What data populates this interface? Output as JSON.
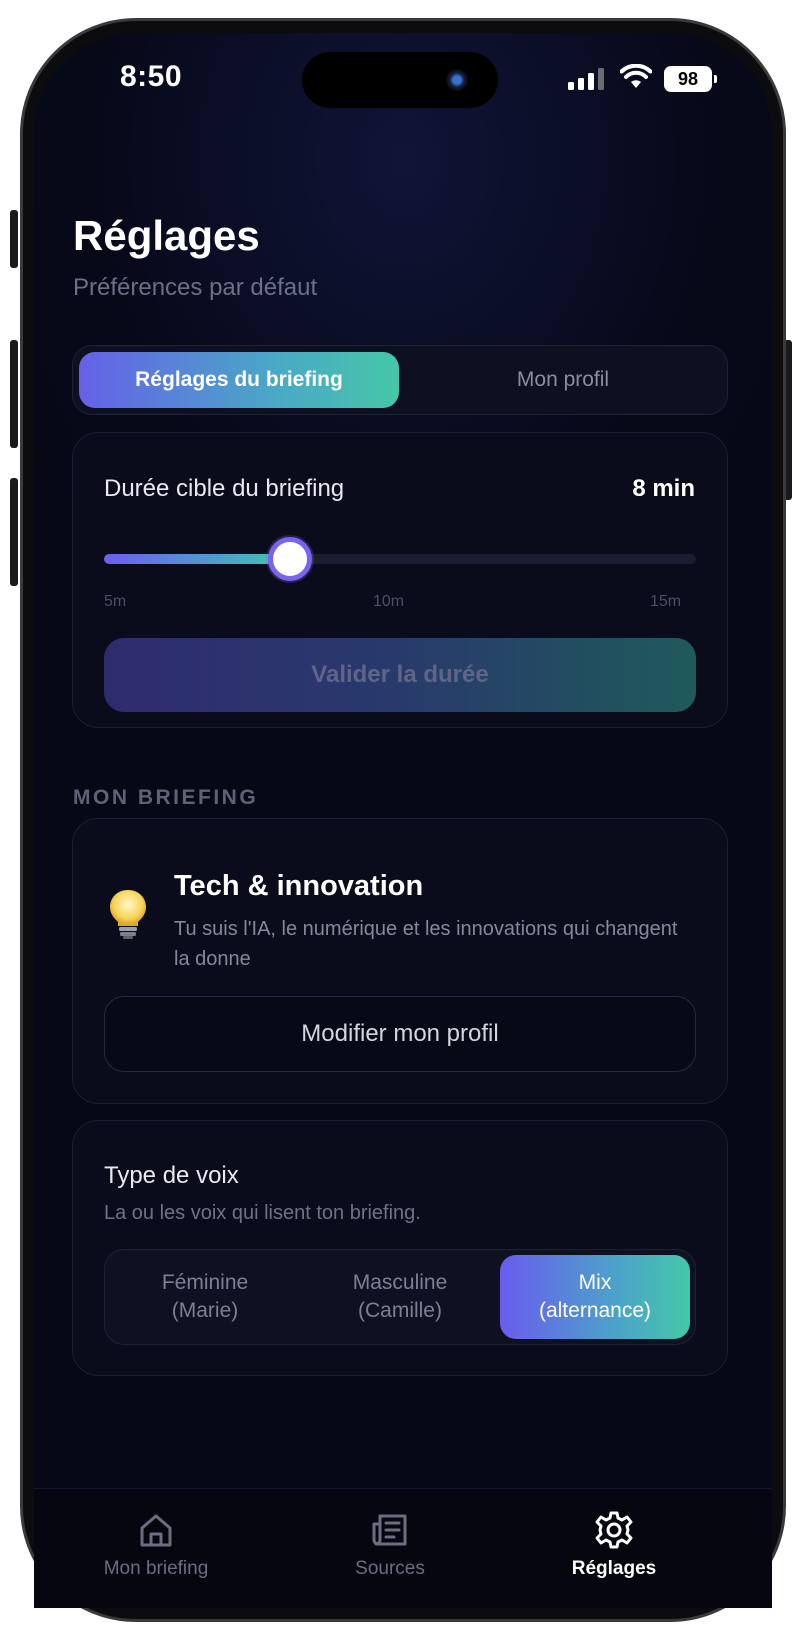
{
  "status_bar": {
    "time": "8:50",
    "battery": "98"
  },
  "header": {
    "title": "Réglages",
    "subtitle": "Préférences par défaut"
  },
  "tabs": [
    {
      "label": "Réglages du briefing",
      "active": true
    },
    {
      "label": "Mon profil",
      "active": false
    }
  ],
  "duration": {
    "label": "Durée cible du briefing",
    "value": "8 min",
    "minutes": 8,
    "min": 5,
    "max": 15,
    "ticks": [
      "5m",
      "10m",
      "15m"
    ],
    "button_label": "Valider la durée"
  },
  "section_label": "MON BRIEFING",
  "profile": {
    "icon": "lightbulb-icon",
    "title": "Tech & innovation",
    "description": "Tu suis l'IA, le numérique et les innovations qui changent la donne",
    "button_label": "Modifier mon profil"
  },
  "voice": {
    "title": "Type de voix",
    "description": "La ou les voix qui lisent ton briefing.",
    "options": [
      {
        "line1": "Féminine",
        "line2": "(Marie)",
        "active": false
      },
      {
        "line1": "Masculine",
        "line2": "(Camille)",
        "active": false
      },
      {
        "line1": "Mix",
        "line2": "(alternance)",
        "active": true
      }
    ]
  },
  "nav": [
    {
      "label": "Mon briefing",
      "icon": "home-icon",
      "active": false
    },
    {
      "label": "Sources",
      "icon": "newspaper-icon",
      "active": false
    },
    {
      "label": "Réglages",
      "icon": "gear-icon",
      "active": true
    }
  ],
  "colors": {
    "background": "#070919",
    "accent_start": "#6660e8",
    "accent_end": "#46c7a8",
    "nav_active": "#ffffff",
    "nav_inactive": "#6b6e82"
  }
}
